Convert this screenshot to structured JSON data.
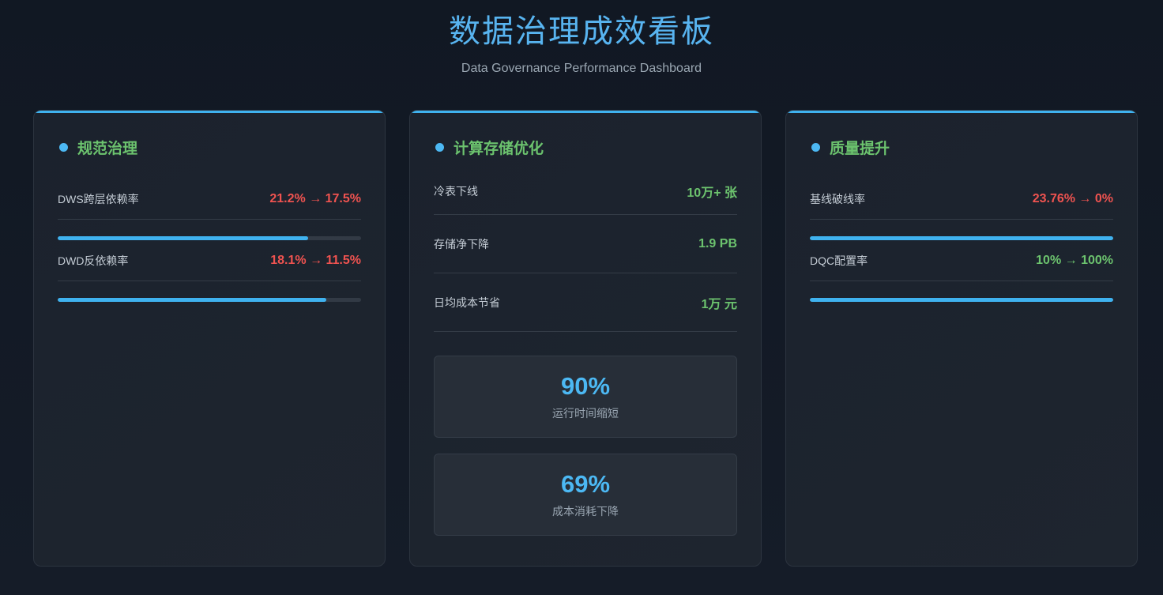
{
  "header": {
    "title": "数据治理成效看板",
    "subtitle": "Data Governance Performance Dashboard"
  },
  "cards": [
    {
      "title": "规范治理",
      "metrics": [
        {
          "label": "DWS跨层依赖率",
          "value": "21.2% → 17.5%",
          "tone": "red",
          "progress": 0.825
        },
        {
          "label": "DWD反依赖率",
          "value": "18.1% → 11.5%",
          "tone": "red",
          "progress": 0.885
        }
      ]
    },
    {
      "title": "计算存储优化",
      "metrics": [
        {
          "label": "冷表下线",
          "value": "10万+ 张",
          "tone": "green"
        },
        {
          "label": "存储净下降",
          "value": "1.9 PB",
          "tone": "green"
        },
        {
          "label": "日均成本节省",
          "value": "1万 元",
          "tone": "green"
        }
      ],
      "stats": [
        {
          "value": "90%",
          "label": "运行时间缩短"
        },
        {
          "value": "69%",
          "label": "成本消耗下降"
        }
      ]
    },
    {
      "title": "质量提升",
      "metrics": [
        {
          "label": "基线破线率",
          "value": "23.76% → 0%",
          "tone": "red",
          "progress": 1.0
        },
        {
          "label": "DQC配置率",
          "value": "10% → 100%",
          "tone": "green",
          "progress": 1.0
        }
      ]
    }
  ],
  "colors": {
    "accent": "#3fb2ef",
    "title": "#58b4f0",
    "good": "#6cc36e",
    "bad": "#ef5350"
  }
}
